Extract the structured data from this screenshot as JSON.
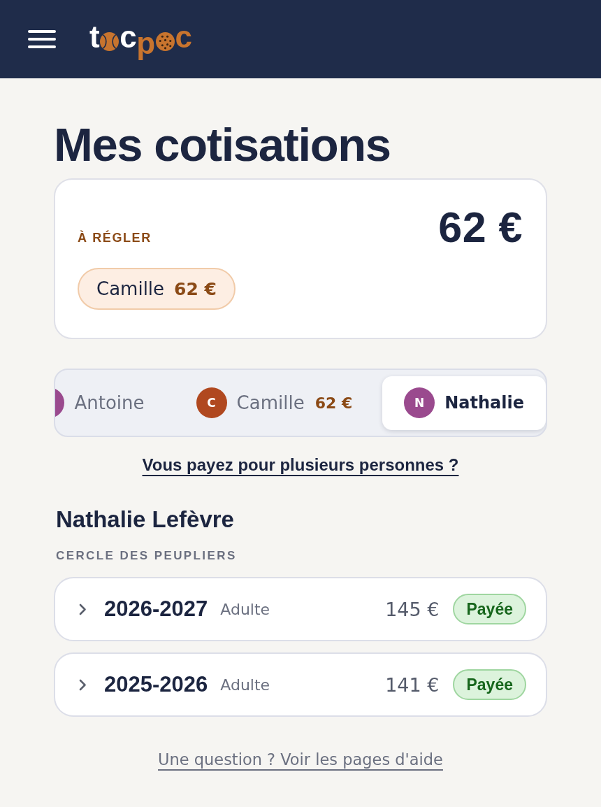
{
  "header": {
    "logo": {
      "letters": [
        "t",
        "c",
        "p",
        "c"
      ]
    }
  },
  "title": "Mes cotisations",
  "summary": {
    "label": "À RÉGLER",
    "total": "62 €",
    "dues": [
      {
        "name": "Camille",
        "amount": "62 €"
      }
    ]
  },
  "member_tabs": [
    {
      "name": "Antoine",
      "color": "#9a4a8e",
      "selected": false
    },
    {
      "name": "Camille",
      "initial": "C",
      "amount": "62 €",
      "color": "#b0481f",
      "selected": false
    },
    {
      "name": "Nathalie",
      "initial": "N",
      "color": "#9a4a8e",
      "selected": true
    }
  ],
  "multi_payer_link": "Vous payez pour plusieurs personnes ?",
  "member": {
    "name": "Nathalie Lefèvre",
    "club": "CERCLE DES PEUPLIERS"
  },
  "seasons": [
    {
      "season": "2026-2027",
      "category": "Adulte",
      "amount": "145 €",
      "status": {
        "label": "Payée",
        "kind": "paid"
      },
      "expanded": false
    },
    {
      "season": "2025-2026",
      "category": "Adulte",
      "amount": "141 €",
      "status": {
        "label": "Payée",
        "kind": "paid"
      },
      "expanded": false
    }
  ],
  "help_link": "Une question ? Voir les pages d'aide"
}
